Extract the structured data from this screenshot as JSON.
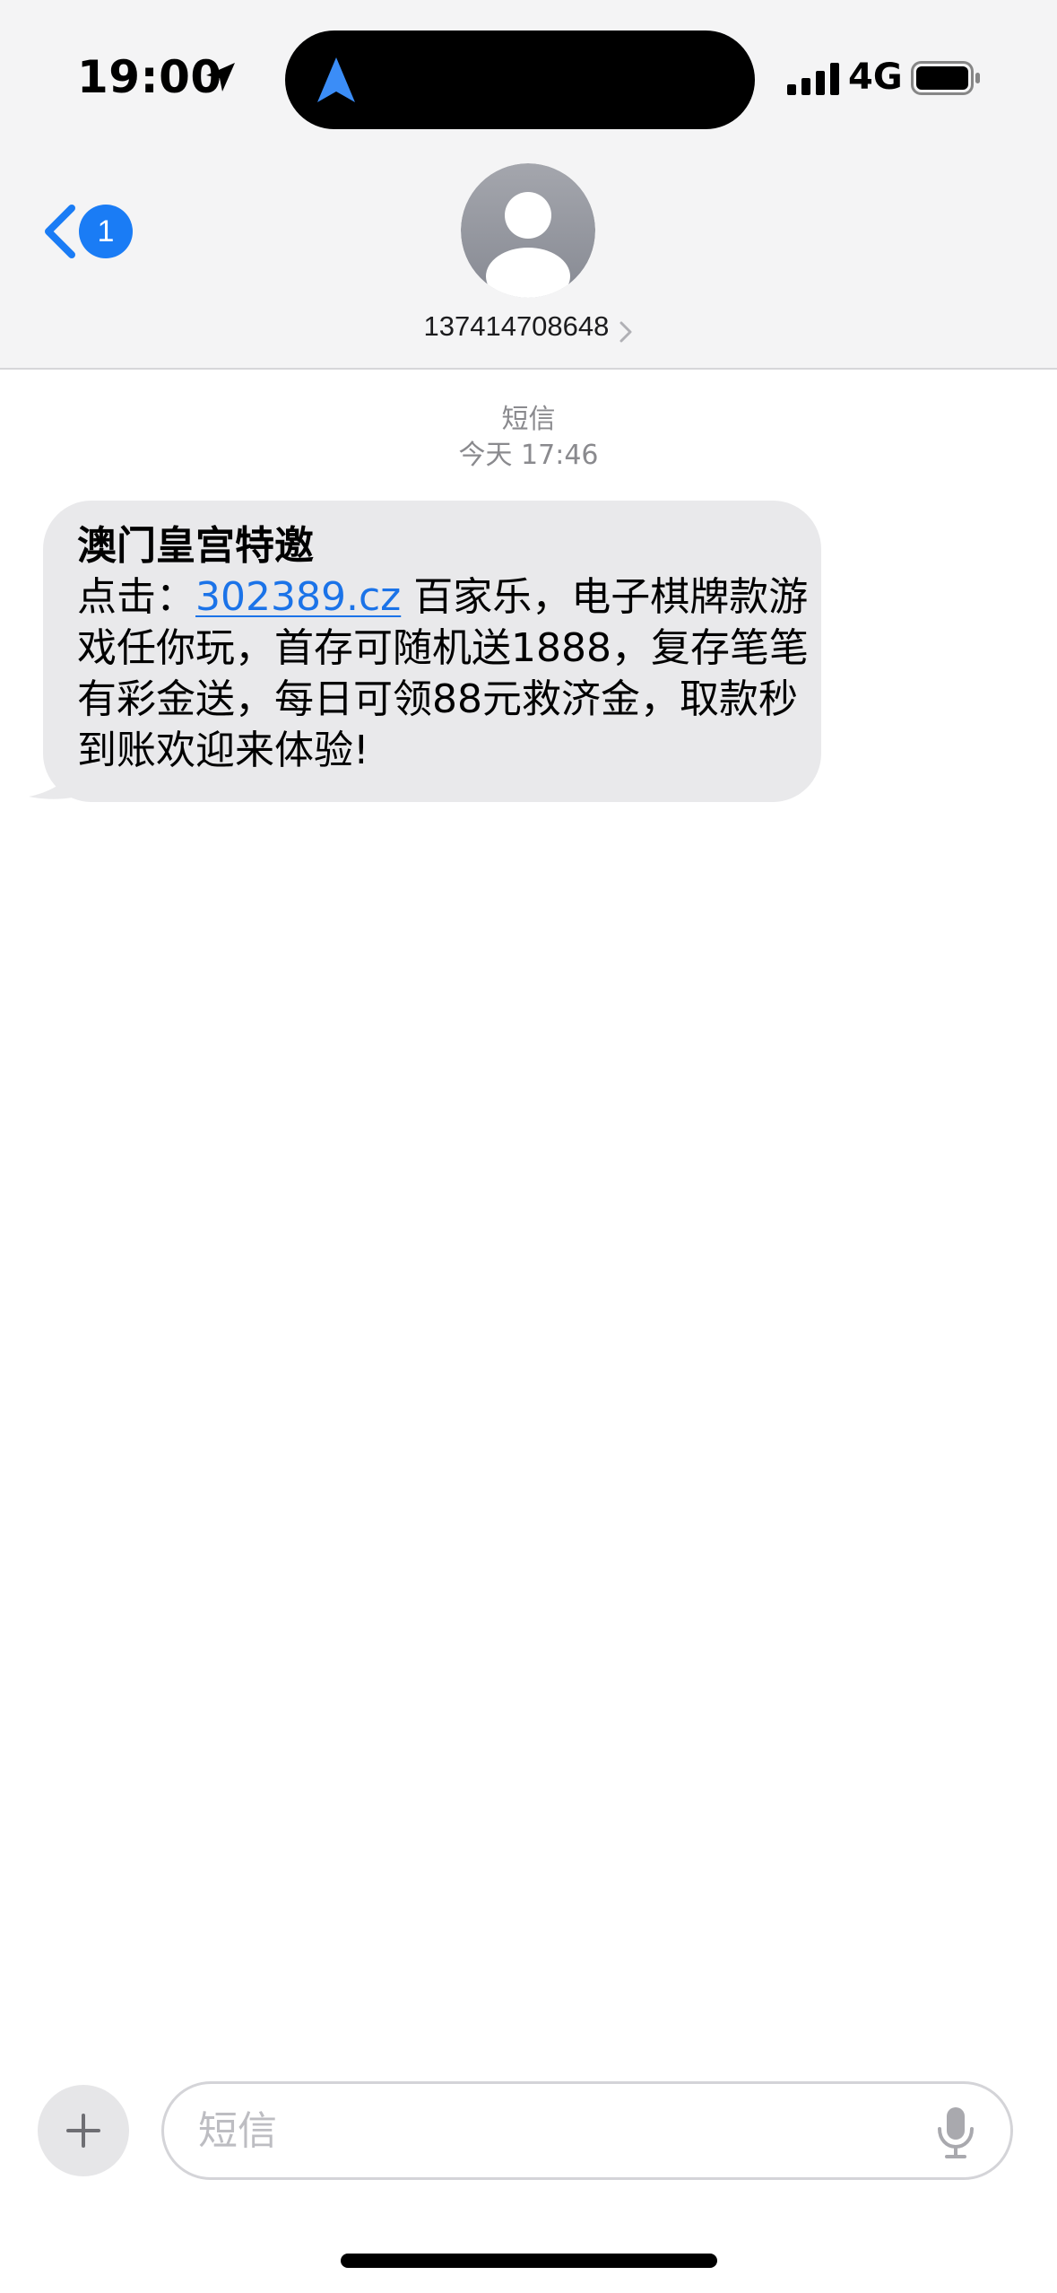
{
  "status_bar": {
    "time": "19:00",
    "network": "4G"
  },
  "nav": {
    "unread_count": "1",
    "contact": "137414708648"
  },
  "conversation": {
    "service": "短信",
    "timestamp": "今天 17:46"
  },
  "message": {
    "title": "澳门皇宫特邀",
    "prefix": "点击：",
    "link": "302389.cz",
    "body": " 百家乐，电子棋牌款游戏任你玩，首存可随机送1888，复存笔笔有彩金送，每日可领88元救济金，取款秒到账欢迎来体验!"
  },
  "composer": {
    "placeholder": "短信"
  },
  "icons": {
    "location": "location-arrow-icon",
    "navigation": "navigation-arrow-icon",
    "signal": "cellular-signal-icon",
    "battery": "battery-icon",
    "back": "chevron-left-icon",
    "avatar": "person-icon",
    "add": "plus-icon",
    "mic": "microphone-icon"
  },
  "colors": {
    "accent": "#1a7cf5",
    "link": "#1b73e8",
    "bubble": "#e9e9eb",
    "header": "#f4f4f5"
  }
}
